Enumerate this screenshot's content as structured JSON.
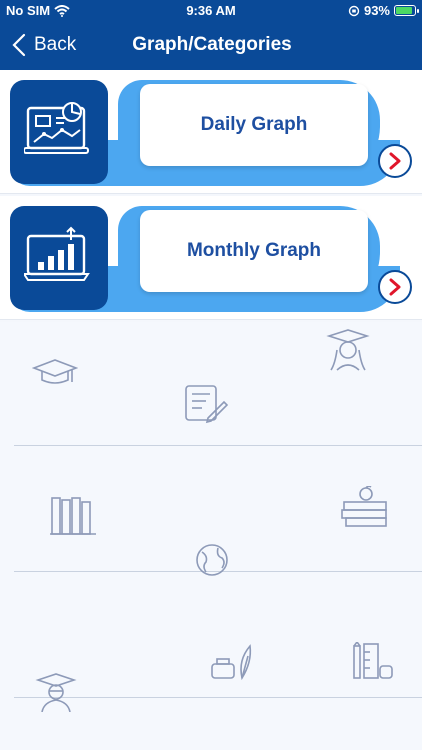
{
  "status_bar": {
    "carrier": "No SIM",
    "time": "9:36 AM",
    "battery_percent": "93%",
    "battery_level": 0.93
  },
  "nav": {
    "back_label": "Back",
    "title": "Graph/Categories"
  },
  "categories": [
    {
      "label": "Daily Graph",
      "icon": "analytics-monitor-icon"
    },
    {
      "label": "Monthly Graph",
      "icon": "bar-chart-laptop-icon"
    }
  ],
  "background_icons": [
    "graduation-cap-icon",
    "student-girl-icon",
    "document-edit-icon",
    "books-icon",
    "books-apple-icon",
    "globe-icon",
    "ink-quill-icon",
    "stationery-icon",
    "graduate-student-icon"
  ],
  "colors": {
    "header": "#0a4a98",
    "card_tab": "#4ca7f0",
    "label_text": "#1e4fa1",
    "arrow_accent": "#e0162b"
  }
}
